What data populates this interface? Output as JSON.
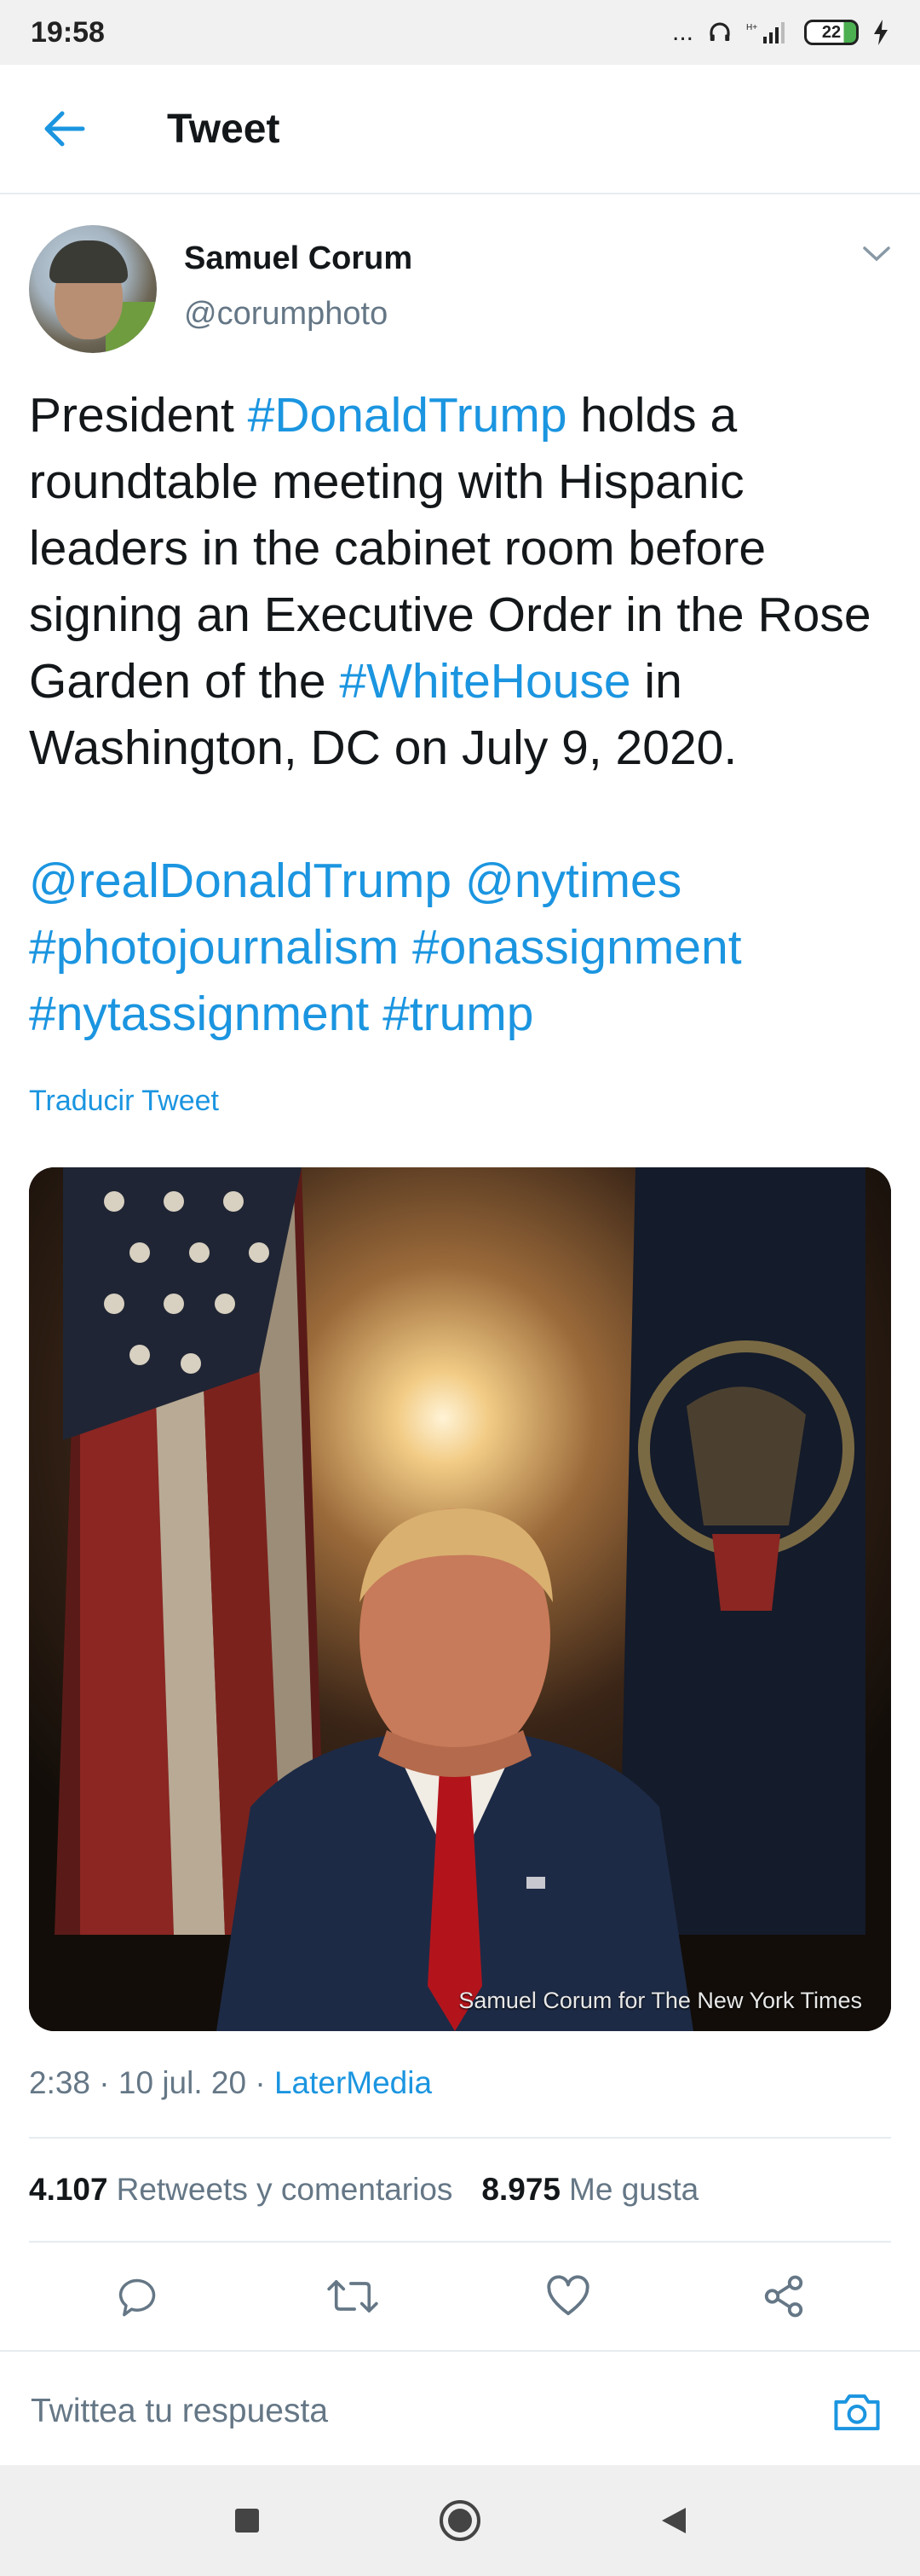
{
  "status_bar": {
    "time": "19:58",
    "battery": "22",
    "indicators": "..."
  },
  "header": {
    "title": "Tweet"
  },
  "tweet": {
    "author": {
      "name": "Samuel Corum",
      "handle": "@corumphoto"
    },
    "text_parts": [
      {
        "t": "President ",
        "link": false
      },
      {
        "t": "#DonaldTrump",
        "link": true
      },
      {
        "t": " holds a roundtable meeting with Hispanic leaders in the cabinet room before signing an Executive Order in the Rose Garden of the ",
        "link": false
      },
      {
        "t": "#WhiteHouse",
        "link": true
      },
      {
        "t": " in Washington, DC on July 9, 2020.\n\n",
        "link": false
      },
      {
        "t": "@realDonaldTrump",
        "link": true
      },
      {
        "t": " ",
        "link": false
      },
      {
        "t": "@nytimes",
        "link": true
      },
      {
        "t": " ",
        "link": false
      },
      {
        "t": "#photojournalism",
        "link": true
      },
      {
        "t": " ",
        "link": false
      },
      {
        "t": "#onassignment",
        "link": true
      },
      {
        "t": " ",
        "link": false
      },
      {
        "t": "#nytassignment",
        "link": true
      },
      {
        "t": " ",
        "link": false
      },
      {
        "t": "#trump",
        "link": true
      }
    ],
    "translate_label": "Traducir Tweet",
    "media_credit": "Samuel Corum for The New York Times",
    "timestamp": "2:38 · 10 jul. 20 · ",
    "source": "LaterMedia",
    "retweets_count": "4.107",
    "retweets_label": "Retweets y comentarios",
    "likes_count": "8.975",
    "likes_label": "Me gusta"
  },
  "reply": {
    "placeholder": "Twittea tu respuesta"
  },
  "icons": {
    "back": "arrow-left-icon",
    "more": "chevron-down-icon",
    "reply": "comment-icon",
    "retweet": "retweet-icon",
    "like": "heart-icon",
    "share": "share-icon",
    "camera": "camera-icon",
    "nav_recent": "square-icon",
    "nav_home": "circle-icon",
    "nav_back": "triangle-back-icon"
  },
  "colors": {
    "link": "#1b95e0",
    "text": "#14171a",
    "secondary": "#657786",
    "divider": "#e6ecf0"
  }
}
